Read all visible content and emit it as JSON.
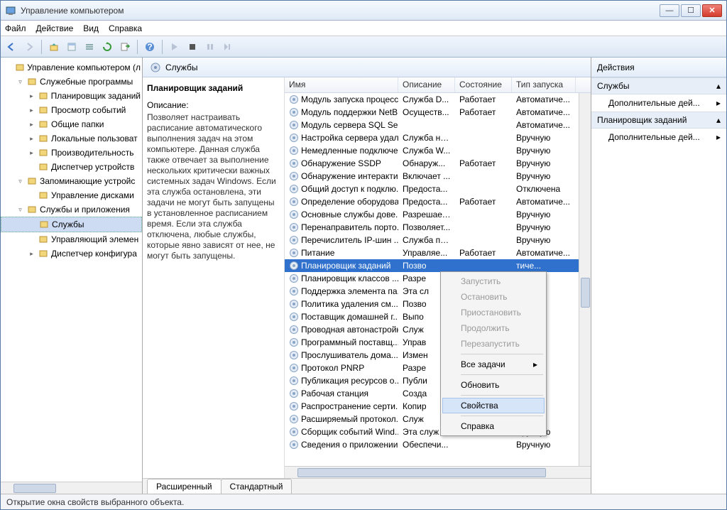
{
  "window": {
    "title": "Управление компьютером"
  },
  "menubar": [
    "Файл",
    "Действие",
    "Вид",
    "Справка"
  ],
  "center": {
    "header": "Службы",
    "service_title": "Планировщик заданий",
    "desc_label": "Описание:",
    "description": "Позволяет настраивать расписание автоматического выполнения задач на этом компьютере. Данная служба также отвечает за выполнение нескольких критически важных системных задач Windows. Если эта служба остановлена, эти задачи не могут быть запущены в установленное расписанием время. Если эта служба отключена, любые службы, которые явно зависят от нее, не могут быть запущены."
  },
  "columns": {
    "name": "Имя",
    "desc": "Описание",
    "state": "Состояние",
    "startup": "Тип запуска"
  },
  "services": [
    {
      "name": "Модуль запуска процесс...",
      "desc": "Служба D...",
      "state": "Работает",
      "startup": "Автоматиче..."
    },
    {
      "name": "Модуль поддержки NetB...",
      "desc": "Осуществ...",
      "state": "Работает",
      "startup": "Автоматиче..."
    },
    {
      "name": "Модуль сервера SQL Ser...",
      "desc": "",
      "state": "",
      "startup": "Автоматиче..."
    },
    {
      "name": "Настройка сервера удал...",
      "desc": "Служба на...",
      "state": "",
      "startup": "Вручную"
    },
    {
      "name": "Немедленные подключе...",
      "desc": "Служба W...",
      "state": "",
      "startup": "Вручную"
    },
    {
      "name": "Обнаружение SSDP",
      "desc": "Обнаруж...",
      "state": "Работает",
      "startup": "Вручную"
    },
    {
      "name": "Обнаружение интеракти...",
      "desc": "Включает ...",
      "state": "",
      "startup": "Вручную"
    },
    {
      "name": "Общий доступ к подклю...",
      "desc": "Предоста...",
      "state": "",
      "startup": "Отключена"
    },
    {
      "name": "Определение оборудова...",
      "desc": "Предоста...",
      "state": "Работает",
      "startup": "Автоматиче..."
    },
    {
      "name": "Основные службы дове...",
      "desc": "Разрешает...",
      "state": "",
      "startup": "Вручную"
    },
    {
      "name": "Перенаправитель порто...",
      "desc": "Позволяет...",
      "state": "",
      "startup": "Вручную"
    },
    {
      "name": "Перечислитель IP-шин ...",
      "desc": "Служба пе...",
      "state": "",
      "startup": "Вручную"
    },
    {
      "name": "Питание",
      "desc": "Управляе...",
      "state": "Работает",
      "startup": "Автоматиче..."
    },
    {
      "name": "Планировщик заданий",
      "desc": "Позво",
      "state": "",
      "startup": "тиче...",
      "sel": true
    },
    {
      "name": "Планировщик классов ...",
      "desc": "Разре",
      "state": "",
      "startup": "атиче..."
    },
    {
      "name": "Поддержка элемента па...",
      "desc": "Эта сл",
      "state": "",
      "startup": "ую"
    },
    {
      "name": "Политика удаления см...",
      "desc": "Позво",
      "state": "",
      "startup": "ую"
    },
    {
      "name": "Поставщик домашней г...",
      "desc": "Выпо",
      "state": "",
      "startup": "ую"
    },
    {
      "name": "Проводная автонастройка",
      "desc": "Служ",
      "state": "",
      "startup": "ую"
    },
    {
      "name": "Программный поставщ...",
      "desc": "Управ",
      "state": "",
      "startup": "ую"
    },
    {
      "name": "Прослушиватель дома...",
      "desc": "Измен",
      "state": "",
      "startup": "ую"
    },
    {
      "name": "Протокол PNRP",
      "desc": "Разре",
      "state": "",
      "startup": "ую"
    },
    {
      "name": "Публикация ресурсов о...",
      "desc": "Публи",
      "state": "",
      "startup": "ую"
    },
    {
      "name": "Рабочая станция",
      "desc": "Созда",
      "state": "",
      "startup": "атиче..."
    },
    {
      "name": "Распространение серти...",
      "desc": "Копир",
      "state": "",
      "startup": "ую"
    },
    {
      "name": "Расширяемый протокол...",
      "desc": "Служ",
      "state": "",
      "startup": "ую"
    },
    {
      "name": "Сборщик событий Wind...",
      "desc": "Эта служб...",
      "state": "",
      "startup": "Вручную"
    },
    {
      "name": "Сведения о приложении",
      "desc": "Обеспечи...",
      "state": "",
      "startup": "Вручную"
    }
  ],
  "tabs": {
    "extended": "Расширенный",
    "standard": "Стандартный"
  },
  "tree": [
    {
      "lvl": 0,
      "tgl": "",
      "label": "Управление компьютером (л",
      "ico": "computer"
    },
    {
      "lvl": 1,
      "tgl": "▿",
      "label": "Служебные программы",
      "ico": "tools"
    },
    {
      "lvl": 2,
      "tgl": "▸",
      "label": "Планировщик заданий",
      "ico": "clock"
    },
    {
      "lvl": 2,
      "tgl": "▸",
      "label": "Просмотр событий",
      "ico": "event"
    },
    {
      "lvl": 2,
      "tgl": "▸",
      "label": "Общие папки",
      "ico": "folder"
    },
    {
      "lvl": 2,
      "tgl": "▸",
      "label": "Локальные пользоват",
      "ico": "users"
    },
    {
      "lvl": 2,
      "tgl": "▸",
      "label": "Производительность",
      "ico": "perf"
    },
    {
      "lvl": 2,
      "tgl": "",
      "label": "Диспетчер устройств",
      "ico": "device"
    },
    {
      "lvl": 1,
      "tgl": "▿",
      "label": "Запоминающие устройс",
      "ico": "storage"
    },
    {
      "lvl": 2,
      "tgl": "",
      "label": "Управление дисками",
      "ico": "disk"
    },
    {
      "lvl": 1,
      "tgl": "▿",
      "label": "Службы и приложения",
      "ico": "apps"
    },
    {
      "lvl": 2,
      "tgl": "",
      "label": "Службы",
      "ico": "service",
      "sel": true
    },
    {
      "lvl": 2,
      "tgl": "",
      "label": "Управляющий элемен",
      "ico": "wmi"
    },
    {
      "lvl": 2,
      "tgl": "▸",
      "label": "Диспетчер конфигура",
      "ico": "sql"
    }
  ],
  "actions": {
    "header": "Действия",
    "groups": [
      {
        "title": "Службы",
        "items": [
          "Дополнительные дей..."
        ]
      },
      {
        "title": "Планировщик заданий",
        "items": [
          "Дополнительные дей..."
        ]
      }
    ]
  },
  "context_menu": {
    "items": [
      {
        "label": "Запустить",
        "disabled": true
      },
      {
        "label": "Остановить",
        "disabled": true
      },
      {
        "label": "Приостановить",
        "disabled": true
      },
      {
        "label": "Продолжить",
        "disabled": true
      },
      {
        "label": "Перезапустить",
        "disabled": true
      },
      {
        "sep": true
      },
      {
        "label": "Все задачи",
        "sub": true
      },
      {
        "sep": true
      },
      {
        "label": "Обновить"
      },
      {
        "sep": true
      },
      {
        "label": "Свойства",
        "hl": true
      },
      {
        "sep": true
      },
      {
        "label": "Справка"
      }
    ]
  },
  "statusbar": "Открытие окна свойств выбранного объекта."
}
